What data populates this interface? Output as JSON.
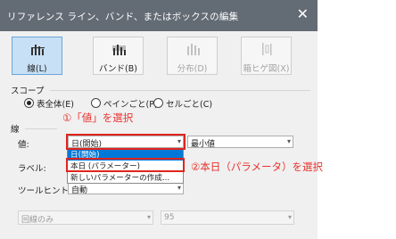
{
  "dialog": {
    "title": "リファレンス ライン、バンド、またはボックスの編集",
    "close_glyph": "✕"
  },
  "toolbar": {
    "line_label": "線(L)",
    "band_label": "バンド(B)",
    "distribution_label": "分布(D)",
    "boxplot_label": "箱ヒゲ図(X)"
  },
  "scope": {
    "heading": "スコープ",
    "options": [
      "表全体(E)",
      "ペインごと(P)",
      "セルごと(C)"
    ],
    "selected": "表全体(E)"
  },
  "line": {
    "heading": "線",
    "value_label": "値:",
    "value_selected": "日(開始)",
    "aggregation": "最小値",
    "label_label": "ラベル:",
    "tooltip_label": "ツールヒント:",
    "tooltip_value": "自動",
    "dropdown_items": [
      "日(開始)",
      "本日 (パラメーター)",
      "新しいパラメーターの作成..."
    ]
  },
  "formatting": {
    "line_only": "回線のみ",
    "percent": "95"
  },
  "annotations": {
    "step1": "①「値」を選択",
    "step2": "②本日（パラメータ）を選択"
  },
  "colors": {
    "titlebar": "#636b75",
    "active_button": "#c7e0f6",
    "selected_item": "#0078d7",
    "annotation_red": "#e8322d"
  }
}
